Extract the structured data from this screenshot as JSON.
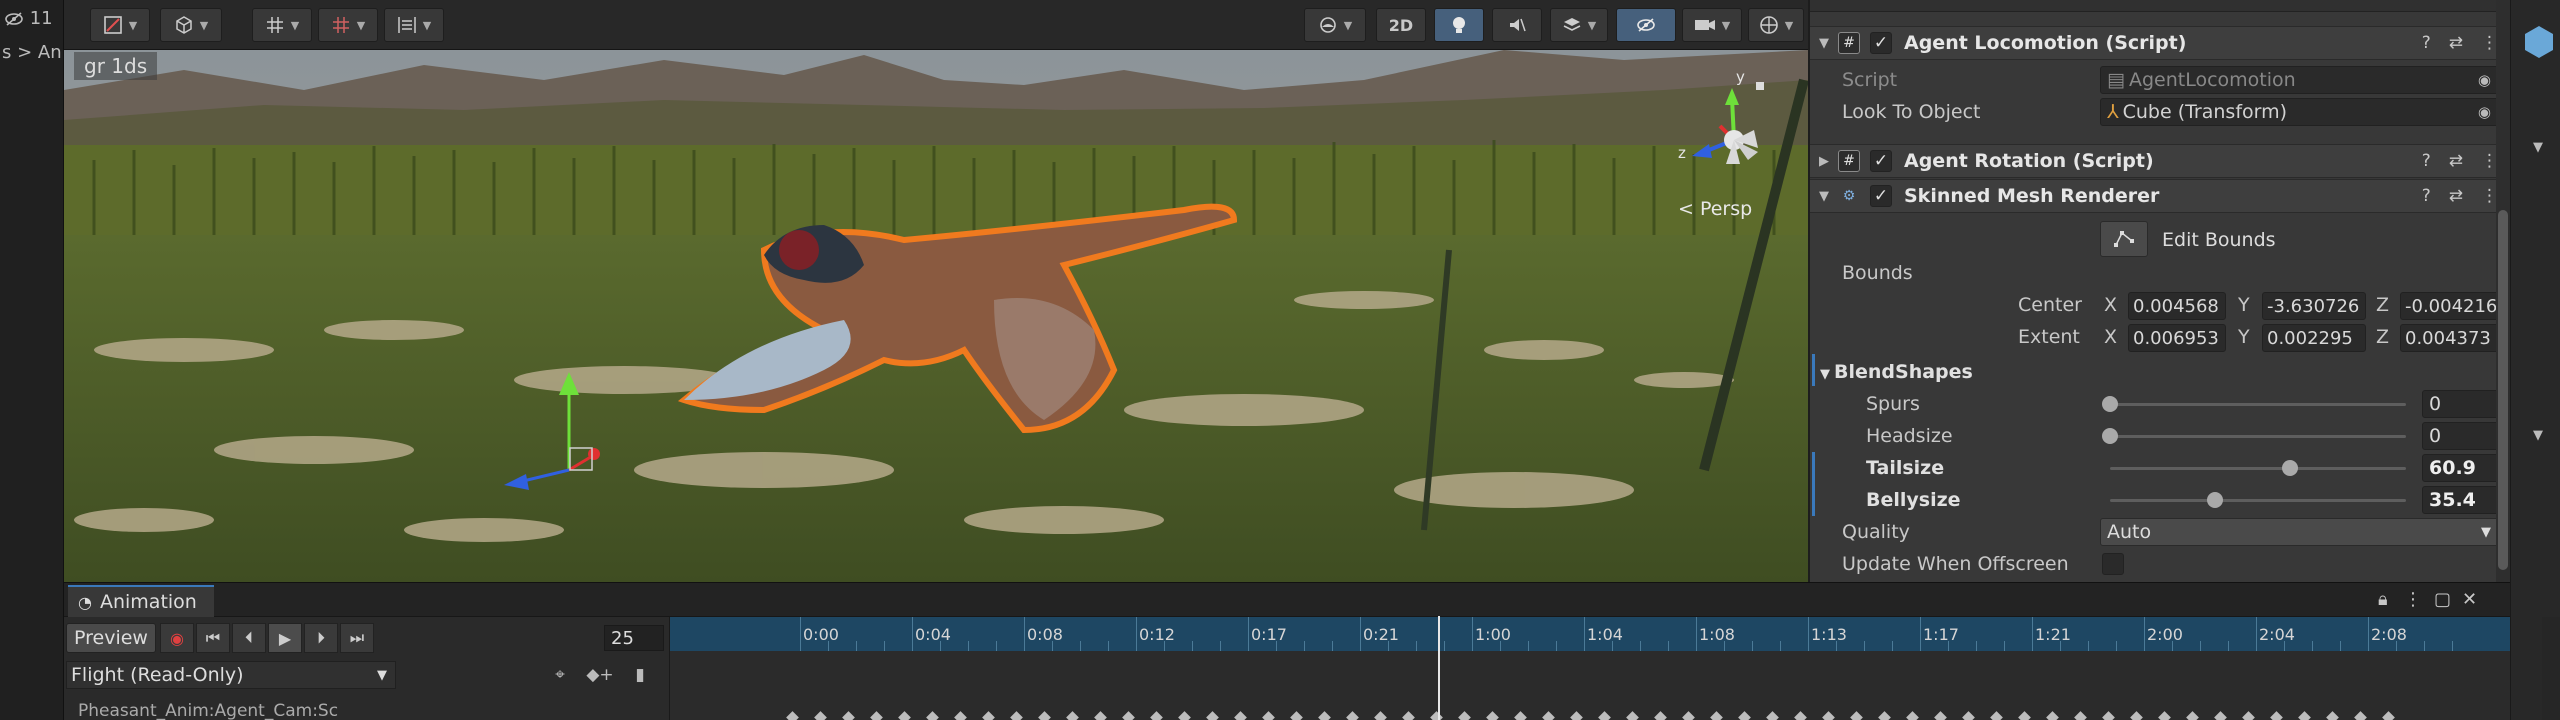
{
  "left": {
    "visible_count": "11",
    "breadcrumb": "s > An"
  },
  "toolbar": {
    "btn_2d": "2D"
  },
  "scene": {
    "stats_chip": "gr 1ds",
    "persp_label": "< Persp",
    "gizmo_y": "y",
    "gizmo_z": "z"
  },
  "inspector": {
    "agent_locomotion": {
      "title": "Agent Locomotion (Script)",
      "script_label": "Script",
      "script_value": "AgentLocomotion",
      "look_label": "Look To Object",
      "look_value": "Cube (Transform)"
    },
    "agent_rotation": {
      "title": "Agent Rotation (Script)"
    },
    "skinned": {
      "title": "Skinned Mesh Renderer",
      "edit_bounds": "Edit Bounds",
      "bounds_label": "Bounds",
      "center_label": "Center",
      "extent_label": "Extent",
      "axis_x": "X",
      "axis_y": "Y",
      "axis_z": "Z",
      "center": {
        "x": "0.004568",
        "y": "-3.630726",
        "z": "-0.004216"
      },
      "extent": {
        "x": "0.006953",
        "y": "0.002295",
        "z": "0.004373"
      },
      "blendshapes_label": "BlendShapes",
      "blendshapes": [
        {
          "name": "Spurs",
          "value": "0",
          "fraction": 0.0,
          "bold": false
        },
        {
          "name": "Headsize",
          "value": "0",
          "fraction": 0.0,
          "bold": false
        },
        {
          "name": "Tailsize",
          "value": "60.9",
          "fraction": 0.609,
          "bold": true
        },
        {
          "name": "Bellysize",
          "value": "35.4",
          "fraction": 0.354,
          "bold": true
        }
      ],
      "quality_label": "Quality",
      "quality_value": "Auto",
      "offscreen_label": "Update When Offscreen"
    }
  },
  "animation": {
    "tab_label": "Animation",
    "preview_label": "Preview",
    "frame_value": "25",
    "clip_value": "Flight (Read-Only)",
    "property_row": "Pheasant_Anim:Agent_Cam:Sc",
    "ticks": [
      "0:00",
      "0:04",
      "0:08",
      "0:12",
      "0:17",
      "0:21",
      "1:00",
      "1:04",
      "1:08",
      "1:13",
      "1:17",
      "1:21",
      "2:00",
      "2:04",
      "2:08"
    ]
  },
  "colors": {
    "accent_blue": "#3a79bb",
    "ruler_bg": "#1e4763",
    "selection_outline": "#f07a1e",
    "panel_bg": "#383838"
  }
}
